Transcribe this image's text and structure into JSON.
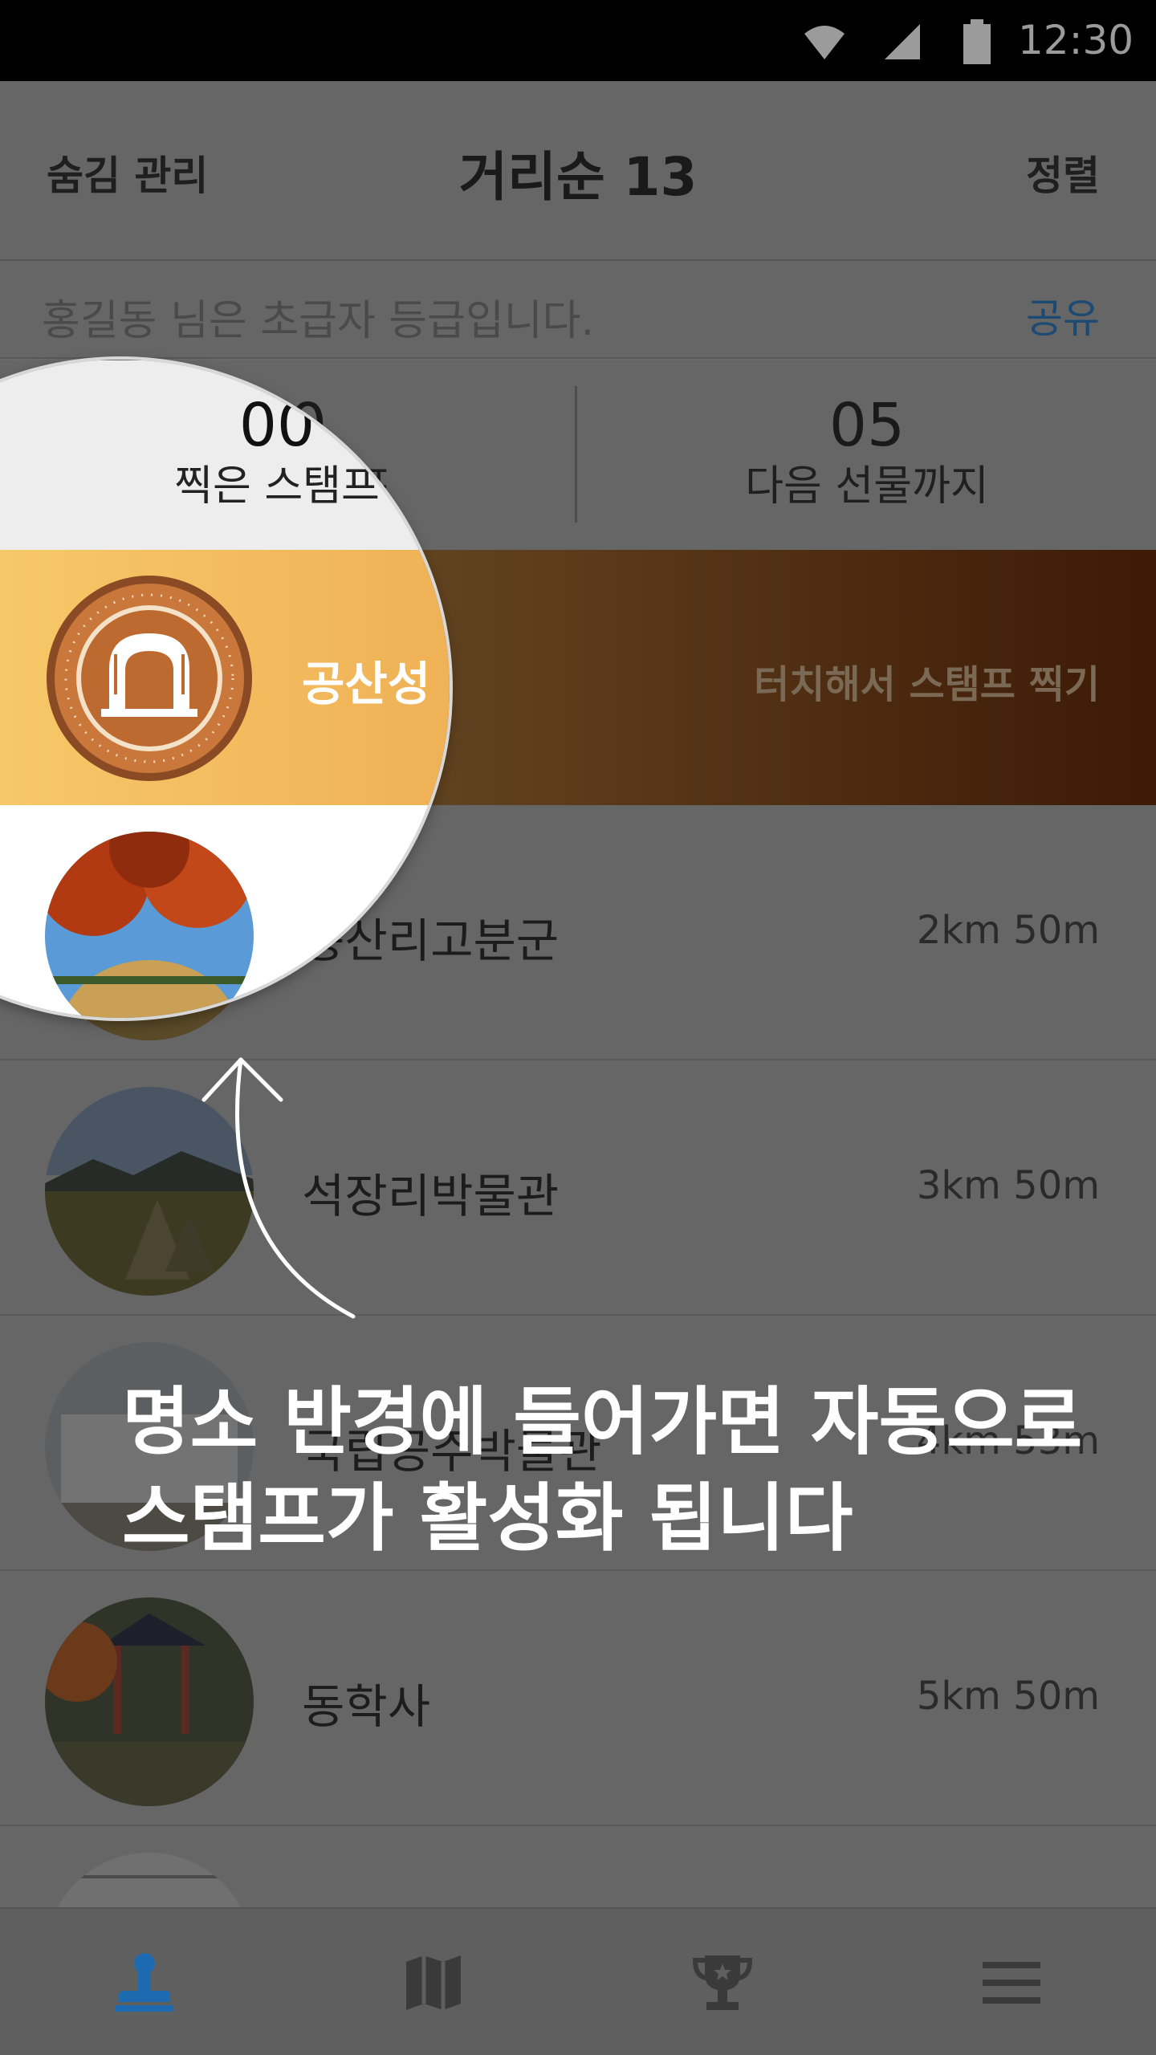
{
  "status_bar": {
    "time": "12:30"
  },
  "header": {
    "left_label": "숨김 관리",
    "title": "거리순 13",
    "right_label": "정렬"
  },
  "grade": {
    "text": "홍길동 님은 초급자 등급입니다.",
    "share_label": "공유"
  },
  "stats": {
    "stamped_count": "00",
    "stamped_label": "찍은 스탬프",
    "next_count": "05",
    "next_label": "다음 선물까지"
  },
  "active_stamp": {
    "name": "공산성",
    "hint": "터치해서 스탬프 찍기"
  },
  "list": [
    {
      "name": "송산리고분군",
      "distance": "2km 50m"
    },
    {
      "name": "석장리박물관",
      "distance": "3km 50m"
    },
    {
      "name": "국립공주박물관",
      "distance": "4km 53m"
    },
    {
      "name": "동학사",
      "distance": "5km 50m"
    },
    {
      "name": "",
      "distance": ""
    }
  ],
  "caption": {
    "line1": "명소 반경에 들어가면 자동으로",
    "line2": "스탬프가 활성화 됩니다"
  },
  "tabbar": {
    "icons": [
      "stamp-icon",
      "map-icon",
      "trophy-icon",
      "menu-icon"
    ]
  },
  "colors": {
    "accent_blue": "#1d6ab0",
    "stamp_gold": "#eca54c",
    "stamp_brown": "#c9773a"
  }
}
